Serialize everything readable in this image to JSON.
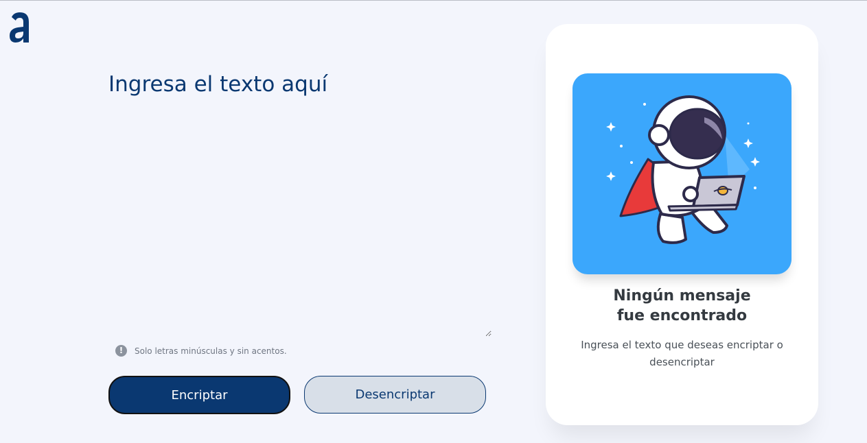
{
  "logo": {
    "icon": "alura-logo-icon",
    "color": "#0a3871"
  },
  "input": {
    "placeholder": "Ingresa el texto aquí",
    "value": ""
  },
  "hint": {
    "icon": "info-icon",
    "text": "Solo letras minúsculas y sin acentos."
  },
  "buttons": {
    "encrypt_label": "Encriptar",
    "decrypt_label": "Desencriptar"
  },
  "output_panel": {
    "illustration": "astronaut-with-laptop-illustration",
    "title_line1": "Ningún mensaje",
    "title_line2": "fue encontrado",
    "description": "Ingresa el texto que deseas encriptar o desencriptar"
  },
  "colors": {
    "primary": "#0a3871",
    "background": "#f3f5fc",
    "illustration_bg": "#3ba7fc"
  }
}
